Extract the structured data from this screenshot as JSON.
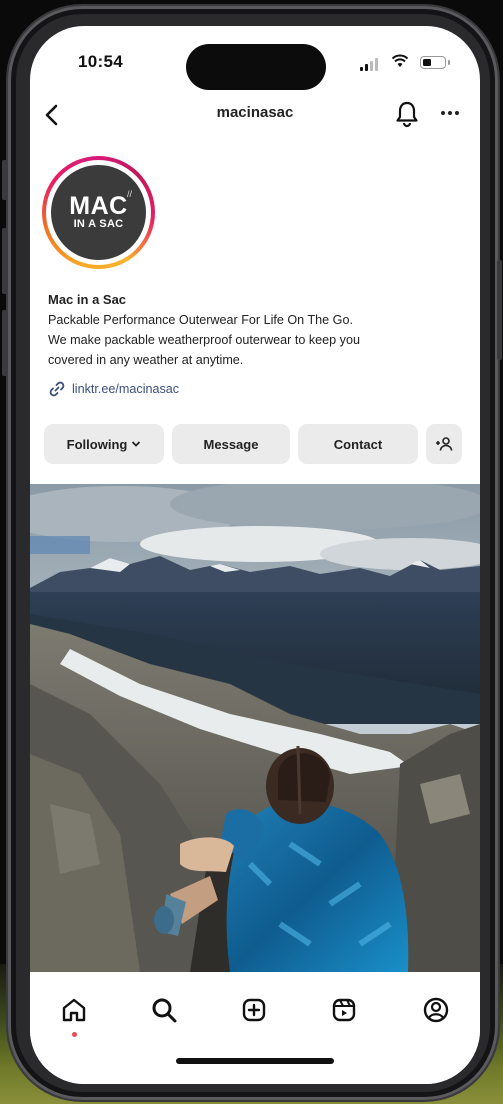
{
  "status_bar": {
    "time": "10:54"
  },
  "header": {
    "username": "macinasac"
  },
  "avatar": {
    "logo_line1": "MAC",
    "logo_line2": "IN A SAC"
  },
  "bio": {
    "name": "Mac in a Sac",
    "line1": "Packable Performance Outerwear For Life On The Go.",
    "line2": "We make packable weatherproof outerwear to keep you",
    "line3": "covered in any weather at anytime.",
    "link": "linktr.ee/macinasac"
  },
  "actions": {
    "following_label": "Following",
    "message_label": "Message",
    "contact_label": "Contact"
  },
  "tabbar": {
    "tabs": [
      "home-icon",
      "search-icon",
      "create-icon",
      "reels-icon",
      "profile-icon"
    ],
    "active": "home-icon",
    "notification_color": "#ed4956"
  },
  "colors": {
    "link": "#3b4f7d",
    "button_bg": "#ebebeb",
    "story_ring": [
      "#f9a825",
      "#e91e63",
      "#c2185b"
    ]
  }
}
